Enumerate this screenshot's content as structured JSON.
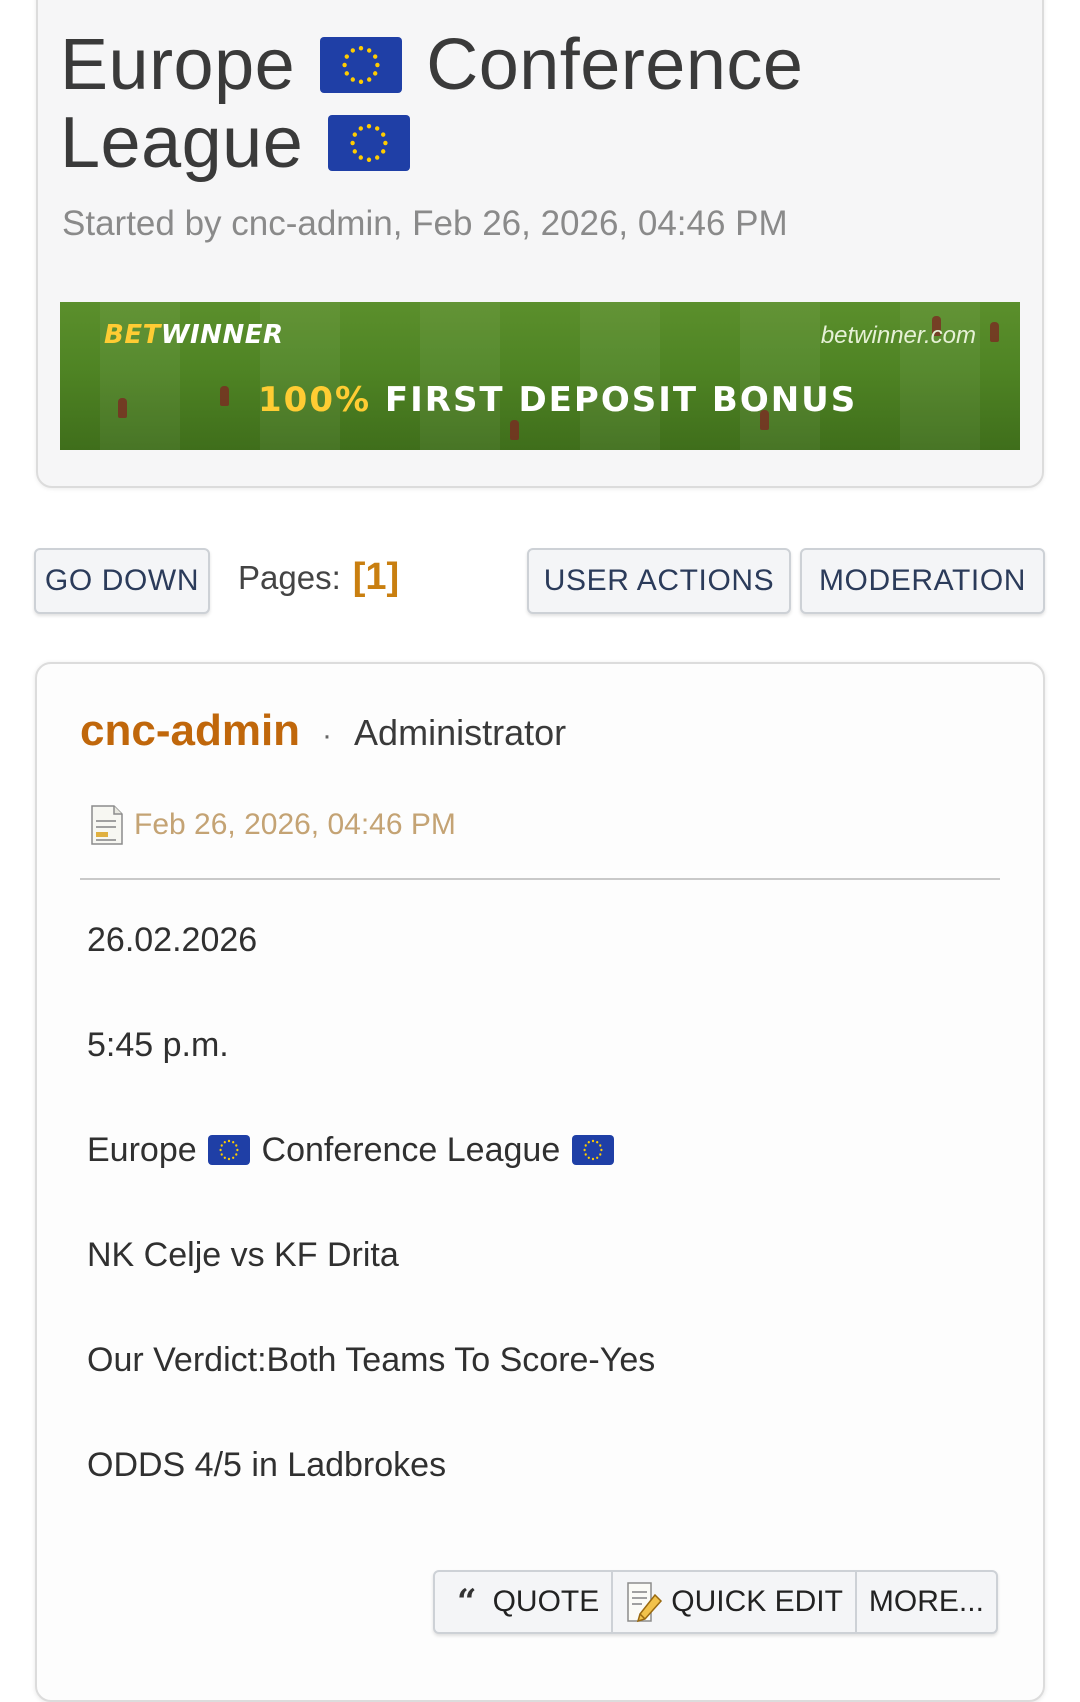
{
  "topic": {
    "title_part1": "Europe",
    "title_part2": "Conference",
    "title_part3": "League",
    "started_by": "Started by cnc-admin, Feb 26, 2026, 04:46 PM"
  },
  "banner": {
    "brand_bet": "BET",
    "brand_winner": "WINNER",
    "domain": "betwinner.com",
    "offer_pct": "100%",
    "offer_text": "FIRST DEPOSIT BONUS"
  },
  "nav": {
    "go_down": "GO DOWN",
    "pages_label": "Pages:",
    "current_page": "[1]",
    "user_actions": "USER ACTIONS",
    "moderation": "MODERATION"
  },
  "post": {
    "poster_name": "cnc-admin",
    "separator": "·",
    "poster_role": "Administrator",
    "date": "Feb 26, 2026, 04:46 PM",
    "lines": {
      "date": "26.02.2026",
      "time": "5:45 p.m.",
      "league_part1": "Europe",
      "league_part2": "Conference League",
      "match": "NK Celje vs KF Drita",
      "verdict": "Our Verdict:Both Teams To Score-Yes",
      "odds": "ODDS 4/5 in Ladbrokes"
    },
    "actions": {
      "quote": "QUOTE",
      "quote_glyph": "“",
      "quick_edit": "QUICK EDIT",
      "more": "MORE..."
    }
  },
  "icons": {
    "flag": "eu-flag-icon",
    "post_doc": "document-icon",
    "quick_edit": "edit-icon"
  },
  "colors": {
    "poster_name": "#c0670b",
    "current_page": "#c97f10",
    "post_date": "#c4a374",
    "button_text": "#2b3b5a",
    "flag_blue": "#1f3fa6",
    "flag_star": "#ffcc00"
  }
}
